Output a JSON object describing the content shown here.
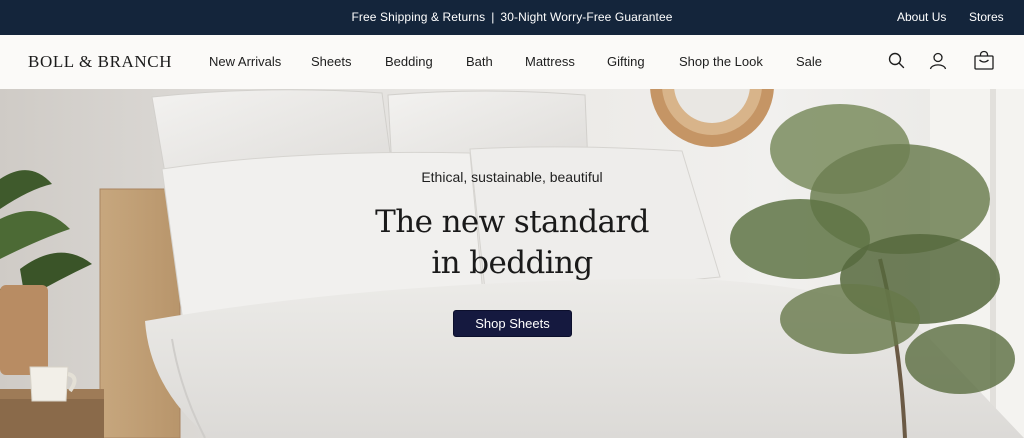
{
  "announcement": {
    "shipping": "Free Shipping & Returns",
    "separator": "|",
    "guarantee": "30-Night Worry-Free Guarantee",
    "links": [
      "About Us",
      "Stores"
    ]
  },
  "header": {
    "logo": "BOLL & BRANCH",
    "nav": [
      "New Arrivals",
      "Sheets",
      "Bedding",
      "Bath",
      "Mattress",
      "Gifting",
      "Shop the Look",
      "Sale"
    ],
    "icons": [
      "search-icon",
      "account-icon",
      "shopping-bag-icon"
    ]
  },
  "hero": {
    "kicker": "Ethical, sustainable, beautiful",
    "headline_line1": "The new standard",
    "headline_line2": "in bedding",
    "cta": "Shop Sheets"
  },
  "colors": {
    "announcement_bg": "#14253b",
    "cta_bg": "#15193f",
    "page_bg": "#fbfaf8"
  }
}
